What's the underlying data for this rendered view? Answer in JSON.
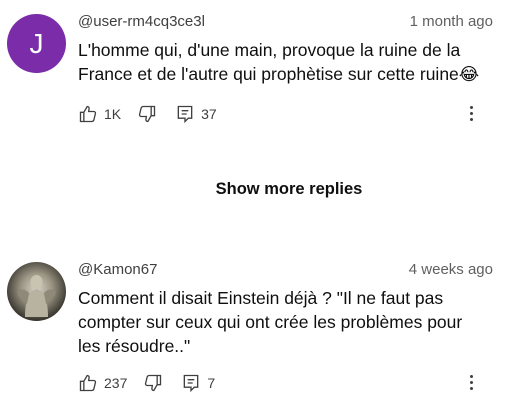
{
  "comments": [
    {
      "avatar_letter": "J",
      "avatar_color": "#7b2ca8",
      "author": "@user-rm4cq3ce3l",
      "time": "1 month ago",
      "text": "L'homme qui, d'une main, provoque la ruine de la France et de l'autre qui prophètise sur cette ruine😂",
      "likes": "1K",
      "replies": "37"
    },
    {
      "author": "@Kamon67",
      "time": "4 weeks ago",
      "text": "Comment il disait Einstein déjà ?  \"Il ne faut pas compter sur ceux qui ont crée les problèmes pour les résoudre..\"",
      "likes": "237",
      "replies": "7"
    }
  ],
  "show_more_label": "Show more replies"
}
